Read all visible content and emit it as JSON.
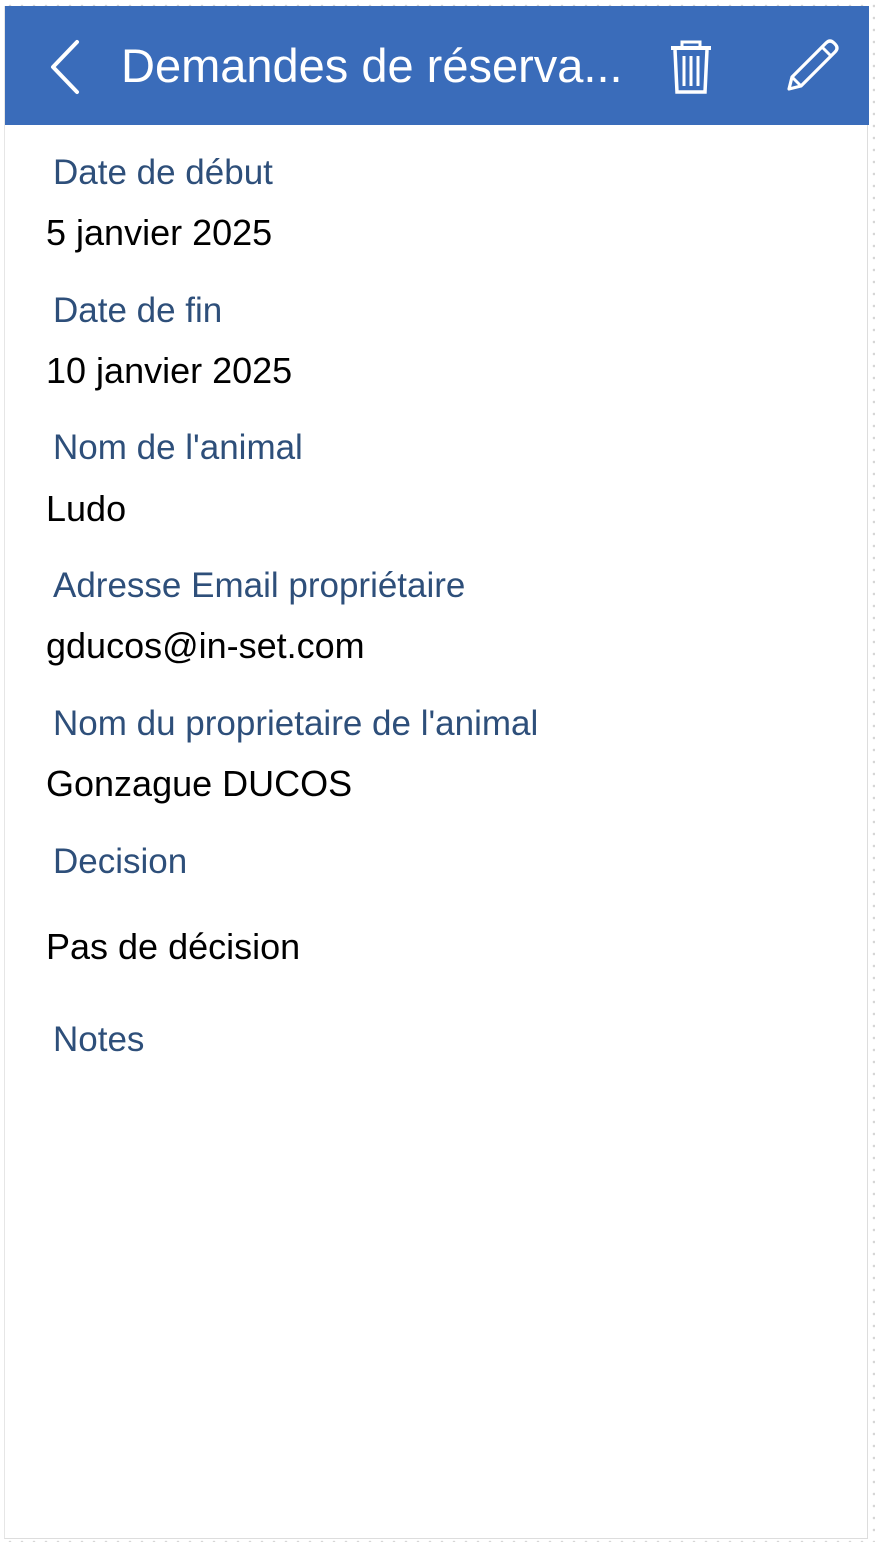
{
  "header": {
    "title": "Demandes de réserva...",
    "background_color": "#3a6cba",
    "back_icon": "chevron-left-icon",
    "delete_icon": "trash-icon",
    "edit_icon": "pencil-icon"
  },
  "fields": [
    {
      "label": "Date de début",
      "value": "5 janvier 2025"
    },
    {
      "label": "Date de fin",
      "value": "10 janvier 2025"
    },
    {
      "label": "Nom de l'animal",
      "value": "Ludo"
    },
    {
      "label": "Adresse Email propriétaire",
      "value": "gducos@in-set.com"
    },
    {
      "label": "Nom du proprietaire de l'animal",
      "value": "Gonzague DUCOS"
    },
    {
      "label": "Decision",
      "value": "Pas de décision"
    },
    {
      "label": "Notes",
      "value": ""
    }
  ],
  "colors": {
    "label": "#2e4f7a",
    "value": "#000000"
  }
}
